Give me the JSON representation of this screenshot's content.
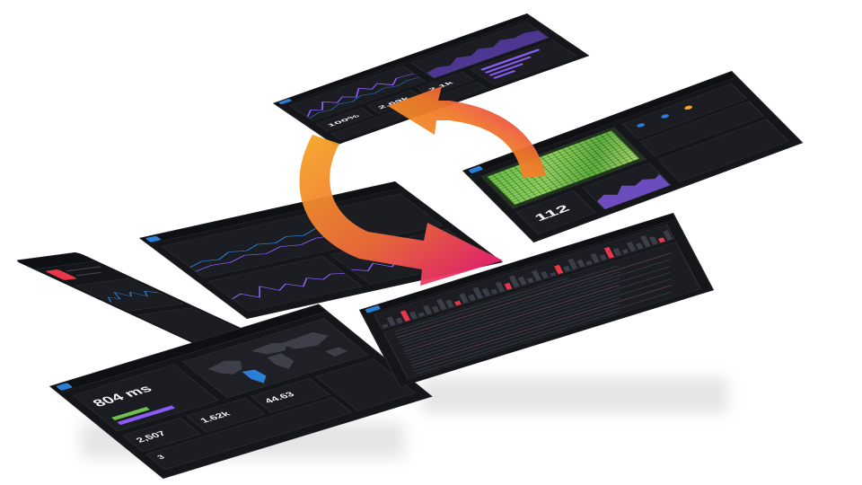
{
  "scene": {
    "colors": {
      "panel_bg": "#15161a",
      "tile_bg": "#1b1d22",
      "accent_blue": "#2c7ed6",
      "accent_purple": "#8a5cf5",
      "accent_green": "#6cc24a",
      "accent_orange": "#f5a623",
      "accent_magenta": "#e6137a"
    },
    "icons": [
      "cycle-arrows-icon"
    ]
  },
  "dashboards": {
    "map": {
      "stat_latency": "804 ms",
      "stat_a": "1.62k",
      "stat_b": "2,507",
      "stat_c": "44.63",
      "stat_d": "3"
    },
    "heatmap": {
      "count": "112"
    },
    "overview": {
      "stat_a": "100%",
      "stat_b": "2.69k",
      "stat_c": "2.1k"
    }
  }
}
